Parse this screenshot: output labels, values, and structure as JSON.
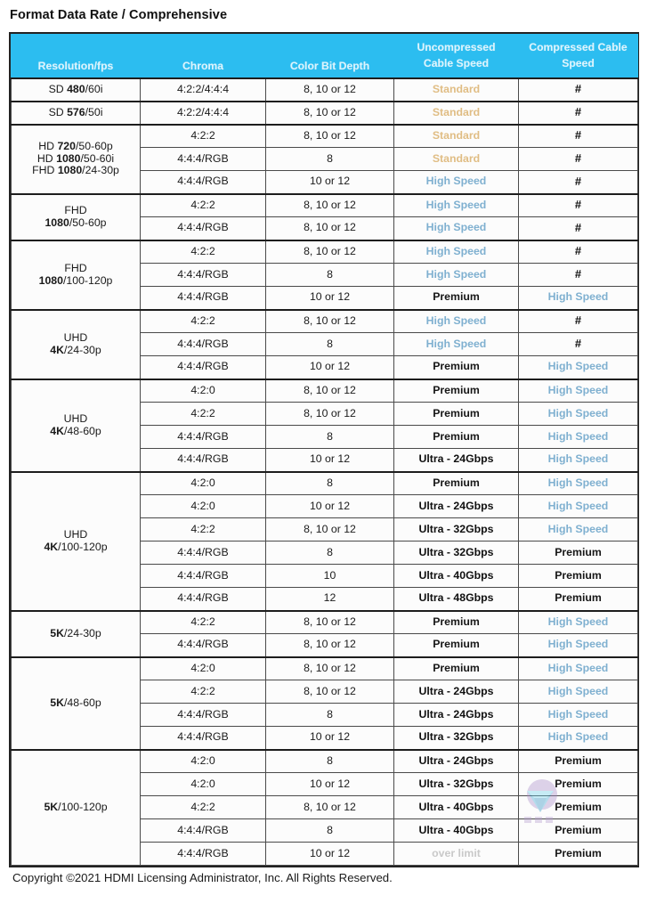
{
  "document": {
    "title": "Format Data Rate / Comprehensive",
    "footer": "Copyright ©2021 HDMI Licensing Administrator, Inc. All Rights Reserved."
  },
  "colors": {
    "header_bg": "#2cbdf0",
    "header_text": "#ddf4fd",
    "standard": "#e0bd84",
    "high_speed": "#7fb0d0",
    "premium": "#161616",
    "over_limit": "#c9c9c9",
    "grid_line": "#4a4a4a",
    "group_line": "#1d1d1d"
  },
  "table": {
    "columns": [
      {
        "id": "resolution",
        "label": "Resolution/fps",
        "lines": [
          "Resolution/fps"
        ]
      },
      {
        "id": "chroma",
        "label": "Chroma",
        "lines": [
          "Chroma"
        ]
      },
      {
        "id": "bitdepth",
        "label": "Color Bit Depth",
        "lines": [
          "Color Bit Depth"
        ]
      },
      {
        "id": "uncompressed",
        "label": "Uncompressed Cable Speed",
        "lines": [
          "Uncompressed",
          "Cable Speed"
        ]
      },
      {
        "id": "compressed",
        "label": "Compressed Cable Speed",
        "lines": [
          "Compressed Cable",
          "Speed"
        ]
      }
    ],
    "groups": [
      {
        "resolution_lines": [
          {
            "pre": "SD ",
            "bold": "480",
            "post": "/60i"
          }
        ],
        "rows": [
          {
            "chroma": "4:2:2/4:4:4",
            "bitdepth": "8, 10 or 12",
            "uncompressed": "Standard",
            "uncompressed_style": "standard",
            "compressed": "#",
            "compressed_style": "hash"
          }
        ]
      },
      {
        "resolution_lines": [
          {
            "pre": "SD ",
            "bold": "576",
            "post": "/50i"
          }
        ],
        "rows": [
          {
            "chroma": "4:2:2/4:4:4",
            "bitdepth": "8, 10 or 12",
            "uncompressed": "Standard",
            "uncompressed_style": "standard",
            "compressed": "#",
            "compressed_style": "hash"
          }
        ]
      },
      {
        "resolution_lines": [
          {
            "pre": "HD ",
            "bold": "720",
            "post": "/50-60p"
          },
          {
            "pre": "HD ",
            "bold": "1080",
            "post": "/50-60i"
          },
          {
            "pre": "FHD ",
            "bold": "1080",
            "post": "/24-30p"
          }
        ],
        "rows": [
          {
            "chroma": "4:2:2",
            "bitdepth": "8, 10 or 12",
            "uncompressed": "Standard",
            "uncompressed_style": "standard",
            "compressed": "#",
            "compressed_style": "hash"
          },
          {
            "chroma": "4:4:4/RGB",
            "bitdepth": "8",
            "uncompressed": "Standard",
            "uncompressed_style": "standard",
            "compressed": "#",
            "compressed_style": "hash"
          },
          {
            "chroma": "4:4:4/RGB",
            "bitdepth": "10 or 12",
            "uncompressed": "High Speed",
            "uncompressed_style": "high",
            "compressed": "#",
            "compressed_style": "hash"
          }
        ]
      },
      {
        "resolution_lines": [
          {
            "pre": "FHD",
            "bold": "",
            "post": ""
          },
          {
            "pre": "",
            "bold": "1080",
            "post": "/50-60p"
          }
        ],
        "rows": [
          {
            "chroma": "4:2:2",
            "bitdepth": "8, 10 or 12",
            "uncompressed": "High Speed",
            "uncompressed_style": "high",
            "compressed": "#",
            "compressed_style": "hash"
          },
          {
            "chroma": "4:4:4/RGB",
            "bitdepth": "8, 10 or 12",
            "uncompressed": "High Speed",
            "uncompressed_style": "high",
            "compressed": "#",
            "compressed_style": "hash"
          }
        ]
      },
      {
        "resolution_lines": [
          {
            "pre": "FHD",
            "bold": "",
            "post": ""
          },
          {
            "pre": "",
            "bold": "1080",
            "post": "/100-120p"
          }
        ],
        "rows": [
          {
            "chroma": "4:2:2",
            "bitdepth": "8, 10 or 12",
            "uncompressed": "High Speed",
            "uncompressed_style": "high",
            "compressed": "#",
            "compressed_style": "hash"
          },
          {
            "chroma": "4:4:4/RGB",
            "bitdepth": "8",
            "uncompressed": "High Speed",
            "uncompressed_style": "high",
            "compressed": "#",
            "compressed_style": "hash"
          },
          {
            "chroma": "4:4:4/RGB",
            "bitdepth": "10 or 12",
            "uncompressed": "Premium",
            "uncompressed_style": "premium",
            "compressed": "High Speed",
            "compressed_style": "high"
          }
        ]
      },
      {
        "resolution_lines": [
          {
            "pre": "UHD",
            "bold": "",
            "post": ""
          },
          {
            "pre": "",
            "bold": "4K",
            "post": "/24-30p"
          }
        ],
        "rows": [
          {
            "chroma": "4:2:2",
            "bitdepth": "8, 10 or 12",
            "uncompressed": "High Speed",
            "uncompressed_style": "high",
            "compressed": "#",
            "compressed_style": "hash"
          },
          {
            "chroma": "4:4:4/RGB",
            "bitdepth": "8",
            "uncompressed": "High Speed",
            "uncompressed_style": "high",
            "compressed": "#",
            "compressed_style": "hash"
          },
          {
            "chroma": "4:4:4/RGB",
            "bitdepth": "10 or 12",
            "uncompressed": "Premium",
            "uncompressed_style": "premium",
            "compressed": "High Speed",
            "compressed_style": "high"
          }
        ]
      },
      {
        "resolution_lines": [
          {
            "pre": "UHD",
            "bold": "",
            "post": ""
          },
          {
            "pre": "",
            "bold": "4K",
            "post": "/48-60p"
          }
        ],
        "rows": [
          {
            "chroma": "4:2:0",
            "bitdepth": "8, 10 or 12",
            "uncompressed": "Premium",
            "uncompressed_style": "premium",
            "compressed": "High Speed",
            "compressed_style": "high"
          },
          {
            "chroma": "4:2:2",
            "bitdepth": "8, 10 or 12",
            "uncompressed": "Premium",
            "uncompressed_style": "premium",
            "compressed": "High Speed",
            "compressed_style": "high"
          },
          {
            "chroma": "4:4:4/RGB",
            "bitdepth": "8",
            "uncompressed": "Premium",
            "uncompressed_style": "premium",
            "compressed": "High Speed",
            "compressed_style": "high"
          },
          {
            "chroma": "4:4:4/RGB",
            "bitdepth": "10 or 12",
            "uncompressed": "Ultra - 24Gbps",
            "uncompressed_style": "ultra",
            "compressed": "High Speed",
            "compressed_style": "high"
          }
        ]
      },
      {
        "resolution_lines": [
          {
            "pre": "UHD",
            "bold": "",
            "post": ""
          },
          {
            "pre": "",
            "bold": "4K",
            "post": "/100-120p"
          }
        ],
        "rows": [
          {
            "chroma": "4:2:0",
            "bitdepth": "8",
            "uncompressed": "Premium",
            "uncompressed_style": "premium",
            "compressed": "High Speed",
            "compressed_style": "high"
          },
          {
            "chroma": "4:2:0",
            "bitdepth": "10 or 12",
            "uncompressed": "Ultra - 24Gbps",
            "uncompressed_style": "ultra",
            "compressed": "High Speed",
            "compressed_style": "high"
          },
          {
            "chroma": "4:2:2",
            "bitdepth": "8, 10 or 12",
            "uncompressed": "Ultra - 32Gbps",
            "uncompressed_style": "ultra",
            "compressed": "High Speed",
            "compressed_style": "high"
          },
          {
            "chroma": "4:4:4/RGB",
            "bitdepth": "8",
            "uncompressed": "Ultra - 32Gbps",
            "uncompressed_style": "ultra",
            "compressed": "Premium",
            "compressed_style": "premium"
          },
          {
            "chroma": "4:4:4/RGB",
            "bitdepth": "10",
            "uncompressed": "Ultra - 40Gbps",
            "uncompressed_style": "ultra",
            "compressed": "Premium",
            "compressed_style": "premium"
          },
          {
            "chroma": "4:4:4/RGB",
            "bitdepth": "12",
            "uncompressed": "Ultra - 48Gbps",
            "uncompressed_style": "ultra",
            "compressed": "Premium",
            "compressed_style": "premium"
          }
        ]
      },
      {
        "resolution_lines": [
          {
            "pre": "",
            "bold": "5K",
            "post": "/24-30p"
          }
        ],
        "rows": [
          {
            "chroma": "4:2:2",
            "bitdepth": "8, 10 or 12",
            "uncompressed": "Premium",
            "uncompressed_style": "premium",
            "compressed": "High Speed",
            "compressed_style": "high"
          },
          {
            "chroma": "4:4:4/RGB",
            "bitdepth": "8, 10 or 12",
            "uncompressed": "Premium",
            "uncompressed_style": "premium",
            "compressed": "High Speed",
            "compressed_style": "high"
          }
        ]
      },
      {
        "resolution_lines": [
          {
            "pre": "",
            "bold": "5K",
            "post": "/48-60p"
          }
        ],
        "rows": [
          {
            "chroma": "4:2:0",
            "bitdepth": "8, 10 or 12",
            "uncompressed": "Premium",
            "uncompressed_style": "premium",
            "compressed": "High Speed",
            "compressed_style": "high"
          },
          {
            "chroma": "4:2:2",
            "bitdepth": "8, 10 or 12",
            "uncompressed": "Ultra - 24Gbps",
            "uncompressed_style": "ultra",
            "compressed": "High Speed",
            "compressed_style": "high"
          },
          {
            "chroma": "4:4:4/RGB",
            "bitdepth": "8",
            "uncompressed": "Ultra - 24Gbps",
            "uncompressed_style": "ultra",
            "compressed": "High Speed",
            "compressed_style": "high"
          },
          {
            "chroma": "4:4:4/RGB",
            "bitdepth": "10 or 12",
            "uncompressed": "Ultra - 32Gbps",
            "uncompressed_style": "ultra",
            "compressed": "High Speed",
            "compressed_style": "high"
          }
        ]
      },
      {
        "resolution_lines": [
          {
            "pre": "",
            "bold": "5K",
            "post": "/100-120p"
          }
        ],
        "rows": [
          {
            "chroma": "4:2:0",
            "bitdepth": "8",
            "uncompressed": "Ultra - 24Gbps",
            "uncompressed_style": "ultra",
            "compressed": "Premium",
            "compressed_style": "premium"
          },
          {
            "chroma": "4:2:0",
            "bitdepth": "10 or 12",
            "uncompressed": "Ultra - 32Gbps",
            "uncompressed_style": "ultra",
            "compressed": "Premium",
            "compressed_style": "premium"
          },
          {
            "chroma": "4:2:2",
            "bitdepth": "8, 10 or 12",
            "uncompressed": "Ultra - 40Gbps",
            "uncompressed_style": "ultra",
            "compressed": "Premium",
            "compressed_style": "premium"
          },
          {
            "chroma": "4:4:4/RGB",
            "bitdepth": "8",
            "uncompressed": "Ultra - 40Gbps",
            "uncompressed_style": "ultra",
            "compressed": "Premium",
            "compressed_style": "premium"
          },
          {
            "chroma": "4:4:4/RGB",
            "bitdepth": "10 or 12",
            "uncompressed": "over limit",
            "uncompressed_style": "over",
            "compressed": "Premium",
            "compressed_style": "premium"
          }
        ]
      }
    ]
  }
}
